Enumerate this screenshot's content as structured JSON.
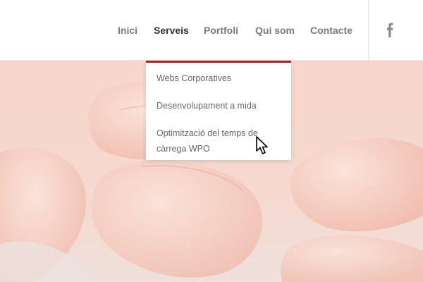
{
  "nav": {
    "items": [
      {
        "label": "Inici"
      },
      {
        "label": "Serveis",
        "active": true
      },
      {
        "label": "Portfoli"
      },
      {
        "label": "Qui som"
      },
      {
        "label": "Contacte"
      }
    ],
    "social_icon": "facebook-icon"
  },
  "dropdown": {
    "items": [
      {
        "label": "Webs Corporatives"
      },
      {
        "label": "Desenvolupament a mida"
      },
      {
        "label_line1": "Optimització del temps de",
        "label_line2": "càrrega WPO"
      }
    ]
  },
  "colors": {
    "accent": "#b32024",
    "nav_text": "#7a7a7a",
    "nav_active": "#333333",
    "hero_tint": "#f4c9bd"
  }
}
